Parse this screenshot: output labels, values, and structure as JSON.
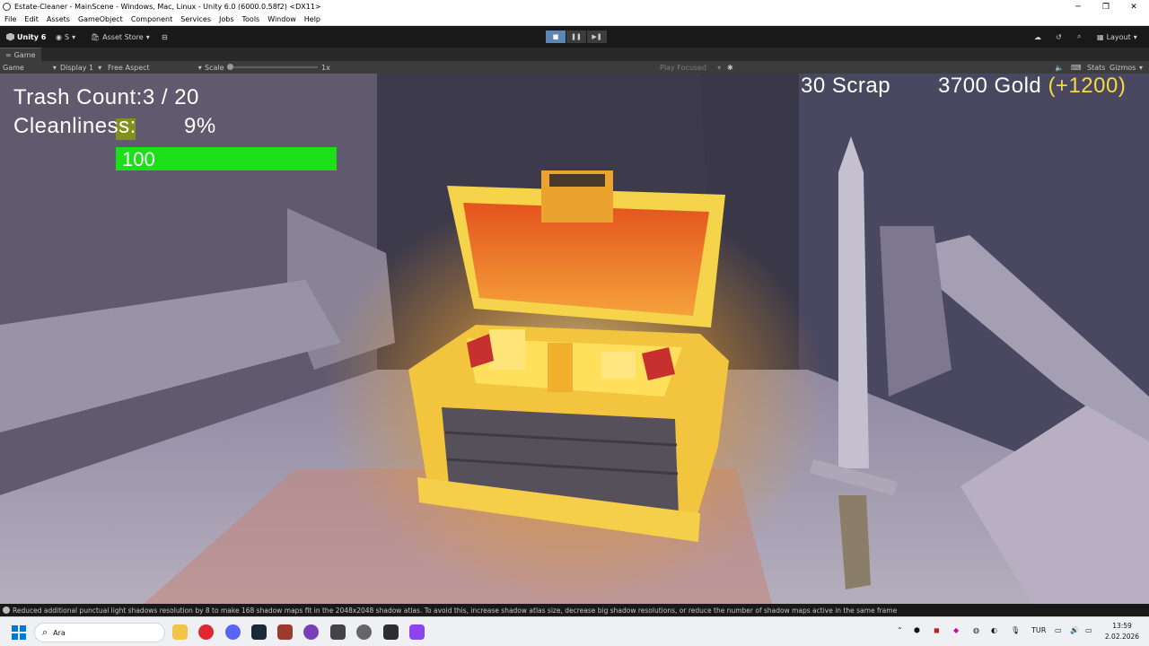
{
  "window": {
    "title": "Estate-Cleaner - MainScene - Windows, Mac, Linux - Unity 6.0 (6000.0.58f2) <DX11>",
    "controls": [
      "─",
      "❐",
      "✕"
    ]
  },
  "menu": [
    "File",
    "Edit",
    "Assets",
    "GameObject",
    "Component",
    "Services",
    "Jobs",
    "Tools",
    "Window",
    "Help"
  ],
  "toolbar": {
    "unity_label": "Unity 6",
    "account_label": "S",
    "asset_store_label": "Asset Store",
    "play_buttons": [
      "■",
      "❚❚",
      "▶❚"
    ],
    "layout_label": "Layout"
  },
  "tab": {
    "label": "Game"
  },
  "game_bar": {
    "mode": "Game",
    "display": "Display 1",
    "aspect": "Free Aspect",
    "scale_label": "Scale",
    "scale_value": "1x",
    "play_focused": "Play Focused",
    "stats": "Stats",
    "gizmos": "Gizmos"
  },
  "hud": {
    "trash_count": "Trash Count:3 / 20",
    "cleanliness_label": "Cleanliness:",
    "cleanliness_value": "9%",
    "health_value": "100",
    "health_fraction": 1.0,
    "scrap": "30 Scrap",
    "gold": "3700 Gold",
    "gold_bonus": "(+1200)",
    "colors": {
      "health": "#1be018",
      "gold_bonus": "#f3dc41",
      "highlight": "#8a9a10"
    }
  },
  "status": {
    "message": "Reduced additional punctual light shadows resolution by 8 to make 168 shadow maps fit in the 2048x2048 shadow atlas. To avoid this, increase shadow atlas size, decrease big shadow resolutions, or reduce the number of shadow maps active in the same frame"
  },
  "taskbar": {
    "search_placeholder": "Ara",
    "language": "TUR",
    "time": "13:59",
    "date": "2.02.2026"
  }
}
